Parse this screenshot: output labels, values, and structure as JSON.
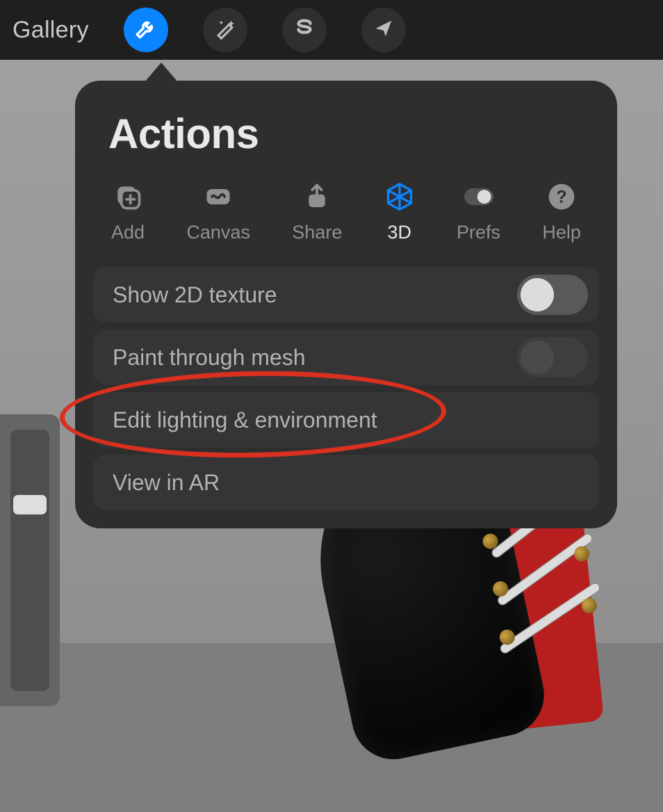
{
  "topbar": {
    "gallery_label": "Gallery"
  },
  "popover": {
    "title": "Actions",
    "tabs": [
      {
        "id": "add",
        "label": "Add"
      },
      {
        "id": "canvas",
        "label": "Canvas"
      },
      {
        "id": "share",
        "label": "Share"
      },
      {
        "id": "3d",
        "label": "3D",
        "active": true
      },
      {
        "id": "prefs",
        "label": "Prefs"
      },
      {
        "id": "help",
        "label": "Help"
      }
    ],
    "rows": {
      "show2d": {
        "label": "Show 2D texture",
        "toggle": false,
        "toggle_light": true
      },
      "paint": {
        "label": "Paint through mesh",
        "toggle": false,
        "toggle_light": false
      },
      "lighting": {
        "label": "Edit lighting & environment"
      },
      "ar": {
        "label": "View in AR"
      }
    }
  },
  "annotation": {
    "highlight_row": "lighting"
  },
  "colors": {
    "accent": "#0a84ff",
    "annotate": "#d9301f"
  }
}
